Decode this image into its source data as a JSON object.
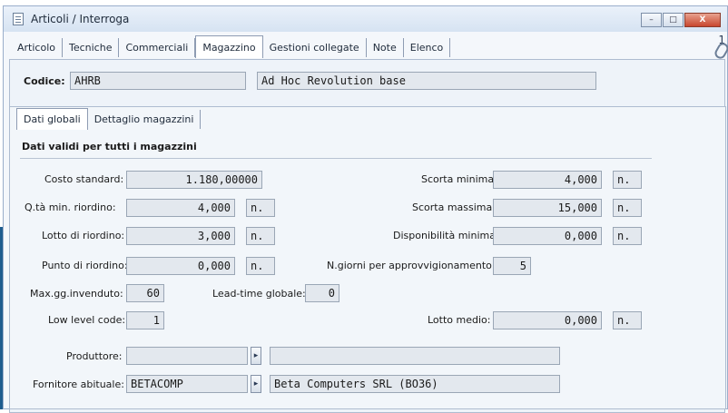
{
  "window": {
    "title": "Articoli / Interroga",
    "buttons": [
      "–",
      "□",
      "X"
    ],
    "attachment_count": "1"
  },
  "tabs": [
    "Articolo",
    "Tecniche",
    "Commerciali",
    "Magazzino",
    "Gestioni collegate",
    "Note",
    "Elenco"
  ],
  "active_tab": "Magazzino",
  "header": {
    "code_label": "Codice:",
    "code": "AHRB",
    "description": "Ad Hoc Revolution base"
  },
  "subtabs": [
    "Dati globali",
    "Dettaglio magazzini"
  ],
  "active_subtab": "Dati globali",
  "section_title": "Dati validi per tutti i magazzini",
  "fields": {
    "costo_standard": {
      "label": "Costo standard:",
      "value": "1.180,00000"
    },
    "qta_min_riordino": {
      "label": "Q.tà min. riordino:",
      "value": "4,000",
      "unit": "n."
    },
    "lotto_riordino": {
      "label": "Lotto di riordino:",
      "value": "3,000",
      "unit": "n."
    },
    "punto_riordino": {
      "label": "Punto di riordino:",
      "value": "0,000",
      "unit": "n."
    },
    "max_gg_invenduto": {
      "label": "Max.gg.invenduto:",
      "value": "60"
    },
    "lead_time": {
      "label": "Lead-time globale:",
      "value": "0"
    },
    "low_level_code": {
      "label": "Low level code:",
      "value": "1"
    },
    "scorta_minima": {
      "label": "Scorta minima:",
      "value": "4,000",
      "unit": "n."
    },
    "scorta_massima": {
      "label": "Scorta massima:",
      "value": "15,000",
      "unit": "n."
    },
    "disponibilita_minima": {
      "label": "Disponibilità minima:",
      "value": "0,000",
      "unit": "n."
    },
    "giorni_approvvigionamento": {
      "label": "N.giorni per approvvigionamento:",
      "value": "5"
    },
    "lotto_medio": {
      "label": "Lotto medio:",
      "value": "0,000",
      "unit": "n."
    },
    "produttore": {
      "label": "Produttore:",
      "code": "",
      "description": ""
    },
    "fornitore": {
      "label": "Fornitore abituale:",
      "code": "BETACOMP",
      "description": "Beta Computers SRL (BO36)"
    }
  }
}
